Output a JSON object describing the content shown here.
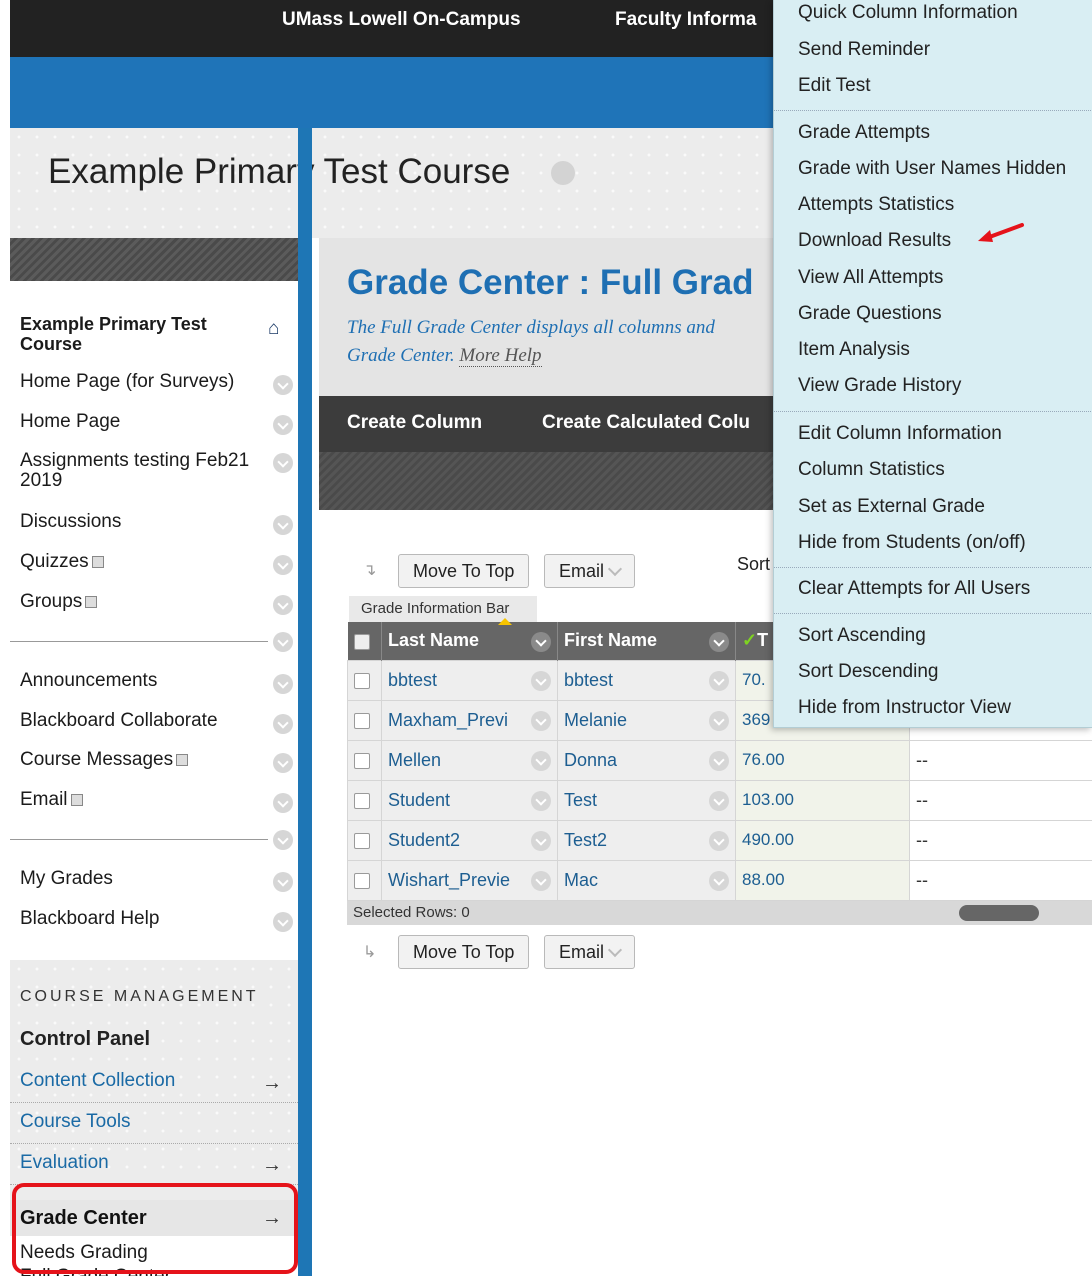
{
  "topbar": {
    "item1": "UMass Lowell On-Campus",
    "item2": "Faculty Informa"
  },
  "course": {
    "title": "Example Primary Test Course"
  },
  "sidebar": {
    "course_link": "Example Primary Test Course",
    "items": [
      {
        "label": "Home Page (for Surveys)"
      },
      {
        "label": "Home Page"
      },
      {
        "label": "Assignments testing Feb21 2019"
      },
      {
        "label": "Discussions"
      },
      {
        "label": "Quizzes"
      },
      {
        "label": "Groups"
      },
      {
        "label": "Announcements"
      },
      {
        "label": "Blackboard Collaborate"
      },
      {
        "label": "Course Messages"
      },
      {
        "label": "Email"
      },
      {
        "label": "My Grades"
      },
      {
        "label": "Blackboard Help"
      }
    ],
    "course_management": {
      "heading": "COURSE MANAGEMENT",
      "control_panel": "Control Panel",
      "links": [
        "Content Collection",
        "Course Tools",
        "Evaluation"
      ],
      "grade_center": "Grade Center",
      "sub_links": [
        "Needs Grading",
        "Full Grade Center"
      ]
    },
    "arrow_glyph": "→"
  },
  "page": {
    "title": "Grade Center : Full Grad",
    "description": "The Full Grade Center displays all columns and",
    "description2": "Grade Center.",
    "more_help": "More Help"
  },
  "actionbar": {
    "create_column": "Create Column",
    "create_calculated": "Create Calculated Colu"
  },
  "grid_controls": {
    "move_to_top": "Move To Top",
    "email": "Email",
    "sort_label": "Sort",
    "info_bar": "Grade Information Bar",
    "selected_rows": "Selected Rows: 0"
  },
  "grid": {
    "columns": [
      "Last Name",
      "First Name",
      "T"
    ],
    "rows": [
      {
        "last": "bbtest",
        "first": "bbtest",
        "score": "70.",
        "other": ""
      },
      {
        "last": "Maxham_Previ",
        "first": "Melanie",
        "score": "369",
        "other": ""
      },
      {
        "last": "Mellen",
        "first": "Donna",
        "score": "76.00",
        "other": "--"
      },
      {
        "last": "Student",
        "first": "Test",
        "score": "103.00",
        "other": "--"
      },
      {
        "last": "Student2",
        "first": "Test2",
        "score": "490.00",
        "other": "--"
      },
      {
        "last": "Wishart_Previe",
        "first": "Mac",
        "score": "88.00",
        "other": "--"
      }
    ]
  },
  "menu": {
    "items": [
      "Quick Column Information",
      "Send Reminder",
      "Edit Test",
      "Grade Attempts",
      "Grade with User Names Hidden",
      "Attempts Statistics",
      "Download Results",
      "View All Attempts",
      "Grade Questions",
      "Item Analysis",
      "View Grade History",
      "Edit Column Information",
      "Column Statistics",
      "Set as External Grade",
      "Hide from Students (on/off)",
      "Clear Attempts for All Users",
      "Sort Ascending",
      "Sort Descending",
      "Hide from Instructor View"
    ]
  },
  "colors": {
    "accent_blue": "#1f74b8",
    "highlight_red": "#e5131a",
    "menu_bg": "#d9eef3"
  },
  "icons": [
    "home-icon",
    "chevron-down-icon",
    "checkmark-icon",
    "right-arrow-icon",
    "red-pointer-arrow-icon"
  ]
}
